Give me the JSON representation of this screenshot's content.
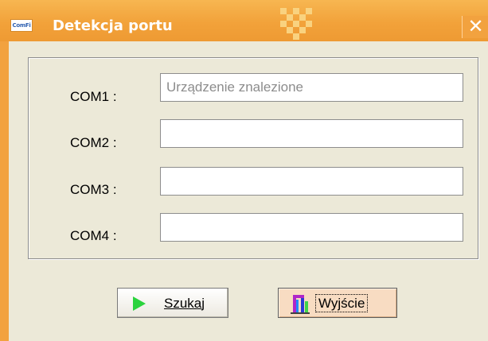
{
  "window": {
    "title": "Detekcja portu",
    "app_icon_text": "ComFi",
    "close_glyph": "✕",
    "colors": {
      "frame": "#f2a23f",
      "client": "#ece9d8",
      "exit_button": "#f8dcc2",
      "play_icon": "#2ad33d"
    }
  },
  "ports": [
    {
      "label": "COM1 :",
      "value": "Urządzenie znalezione"
    },
    {
      "label": "COM2 :",
      "value": ""
    },
    {
      "label": "COM3 :",
      "value": ""
    },
    {
      "label": "COM4 :",
      "value": ""
    }
  ],
  "buttons": {
    "search": {
      "label": "Szukaj",
      "icon": "play-icon"
    },
    "exit": {
      "label": "Wyjście",
      "icon": "door-exit-icon"
    }
  }
}
